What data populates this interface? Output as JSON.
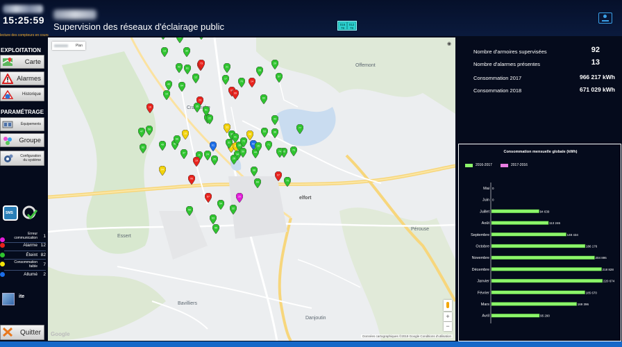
{
  "header": {
    "clock": "15:25:59",
    "title": "Supervision des réseaux d'éclairage public",
    "status_line": "lecture des compteurs en cours",
    "badge_left": [
      "016",
      "78"
    ],
    "badge_right": [
      "012",
      "78"
    ]
  },
  "sidebar": {
    "exploitation_title": "EXPLOITATION",
    "carte": "Carte",
    "alarmes": "Alarmes",
    "historique": "Historique",
    "parametrage_title": "PARAMÉTRAGE",
    "equipements": "Équipements",
    "groupe": "Groupe",
    "configuration_l1": "Configuration",
    "configuration_l2": "du système",
    "legend": [
      {
        "label_l1": "Erreur",
        "label_l2": "communication",
        "count": "1",
        "color": "#e21dd9"
      },
      {
        "label_l1": "Alarme",
        "label_l2": "",
        "count": "12",
        "color": "#e8231d"
      },
      {
        "label_l1": "Éteint",
        "label_l2": "",
        "count": "82",
        "color": "#2fc42f"
      },
      {
        "label_l1": "Consommation",
        "label_l2": "faible",
        "count": "7",
        "color": "#f2e20a"
      },
      {
        "label_l1": "Allumé",
        "label_l2": "",
        "count": "2",
        "color": "#1c6ee8"
      }
    ],
    "site_label": "ite",
    "quit": "Quitter"
  },
  "map": {
    "type_label": "Plan",
    "places": {
      "offemont": "Offemont",
      "cravanche": "Cravanche",
      "essert": "Essert",
      "perouse": "Pérouse",
      "bavilliers": "Bavilliers",
      "danjoutin": "Danjoutin",
      "belfort": "elfort"
    },
    "attribution": "Données cartographiques ©2019 Google    Conditions d'utilisation",
    "google": "Google",
    "pins": [
      {
        "status": "green",
        "id": "52"
      },
      {
        "status": "green",
        "id": "08"
      },
      {
        "status": "green",
        "id": "27"
      },
      {
        "status": "green",
        "id": "13"
      },
      {
        "status": "green",
        "id": "40"
      },
      {
        "status": "green",
        "id": "30"
      },
      {
        "status": "red",
        "id": "05"
      },
      {
        "status": "green",
        "id": "61"
      },
      {
        "status": "red",
        "id": "23"
      },
      {
        "status": "green",
        "id": "12"
      },
      {
        "status": "green",
        "id": "42"
      },
      {
        "status": "red",
        "id": "73"
      },
      {
        "status": "red",
        "id": "16"
      },
      {
        "status": "green",
        "id": "64"
      },
      {
        "status": "green",
        "id": "35"
      },
      {
        "status": "green",
        "id": "10"
      },
      {
        "status": "green",
        "id": "45"
      },
      {
        "status": "green",
        "id": "17"
      },
      {
        "status": "green",
        "id": "21"
      },
      {
        "status": "red",
        "id": "03"
      },
      {
        "status": "red",
        "id": "09"
      },
      {
        "status": "green",
        "id": "51"
      },
      {
        "status": "yellow",
        "id": "33"
      },
      {
        "status": "green",
        "id": "70"
      },
      {
        "status": "red",
        "id": "14"
      },
      {
        "status": "green",
        "id": "28"
      },
      {
        "status": "green",
        "id": "60"
      },
      {
        "status": "green",
        "id": "29"
      },
      {
        "status": "green",
        "id": "57"
      },
      {
        "status": "green",
        "id": "43"
      },
      {
        "status": "green",
        "id": "22"
      },
      {
        "status": "blue",
        "id": "01"
      },
      {
        "status": "green",
        "id": "36"
      },
      {
        "status": "green",
        "id": "47"
      },
      {
        "status": "green",
        "id": "58"
      },
      {
        "status": "green",
        "id": "62"
      },
      {
        "status": "yellow",
        "id": "04"
      },
      {
        "status": "yellow",
        "id": "18"
      },
      {
        "status": "green",
        "id": "49"
      },
      {
        "status": "green",
        "id": "56"
      },
      {
        "status": "green",
        "id": "66"
      },
      {
        "status": "green",
        "id": "37"
      },
      {
        "status": "green",
        "id": "11"
      },
      {
        "status": "red",
        "id": "19"
      },
      {
        "status": "red",
        "id": "06"
      },
      {
        "status": "green",
        "id": "24"
      },
      {
        "status": "green",
        "id": "25"
      },
      {
        "status": "yellow",
        "id": "57"
      },
      {
        "status": "green",
        "id": "39"
      },
      {
        "status": "green",
        "id": "31"
      },
      {
        "status": "green",
        "id": "41"
      },
      {
        "status": "yellow",
        "id": "46"
      },
      {
        "status": "green",
        "id": "38"
      },
      {
        "status": "green",
        "id": "72"
      },
      {
        "status": "blue",
        "id": "02"
      },
      {
        "status": "green",
        "id": "53"
      },
      {
        "status": "green",
        "id": "44"
      },
      {
        "status": "green",
        "id": "15"
      },
      {
        "status": "green",
        "id": "34"
      },
      {
        "status": "green",
        "id": "26"
      },
      {
        "status": "yellow",
        "id": "48"
      },
      {
        "status": "green",
        "id": "59"
      },
      {
        "status": "green",
        "id": "65"
      },
      {
        "status": "red",
        "id": "07"
      },
      {
        "status": "magenta",
        "id": "20"
      },
      {
        "status": "green",
        "id": "54"
      },
      {
        "status": "green",
        "id": "32"
      },
      {
        "status": "green",
        "id": "55"
      },
      {
        "status": "green",
        "id": "50"
      },
      {
        "status": "green",
        "id": "63"
      },
      {
        "status": "red",
        "id": "67"
      },
      {
        "status": "green",
        "id": "68"
      },
      {
        "status": "green",
        "id": "69"
      },
      {
        "status": "green",
        "id": "71"
      },
      {
        "status": "green",
        "id": "74"
      },
      {
        "status": "green",
        "id": "75"
      },
      {
        "status": "green",
        "id": "76"
      },
      {
        "status": "green",
        "id": "77"
      }
    ]
  },
  "stats": {
    "armoires_label": "Nombre d'armoires supervisées",
    "armoires_value": "92",
    "alarmes_label": "Nombre d'alarmes présentes",
    "alarmes_value": "13",
    "conso2017_label": "Consommation 2017",
    "conso2017_value": "966 217 kWh",
    "conso2018_label": "Consommation 2018",
    "conso2018_value": "671 029 kWh"
  },
  "chart_data": {
    "type": "bar",
    "orientation": "horizontal",
    "title": "Consommation mensuelle globale (kWh)",
    "categories": [
      "Mai",
      "Juin",
      "Juillet",
      "Août",
      "Septembre",
      "Octobre",
      "Novembre",
      "Décembre",
      "Janvier",
      "Février",
      "Mars",
      "Avril"
    ],
    "series": [
      {
        "name": "2016-2017",
        "color": "#8cf56a",
        "values": [
          0,
          0,
          94639,
          113246,
          148434,
          186176,
          204895,
          218828,
          220674,
          185670,
          169396,
          95290
        ]
      },
      {
        "name": "2017-2016",
        "color": "#e87ce0",
        "values": [
          null,
          null,
          null,
          null,
          null,
          null,
          null,
          null,
          null,
          null,
          null,
          null
        ]
      }
    ],
    "value_labels": [
      "0",
      "0",
      "94 639",
      "113 246",
      "148 434",
      "186 176",
      "204 895",
      "218 828",
      "220 674",
      "185 670",
      "169 396",
      "95 290"
    ],
    "xlim": [
      0,
      240000
    ],
    "grid": false,
    "legend": "top-left"
  }
}
